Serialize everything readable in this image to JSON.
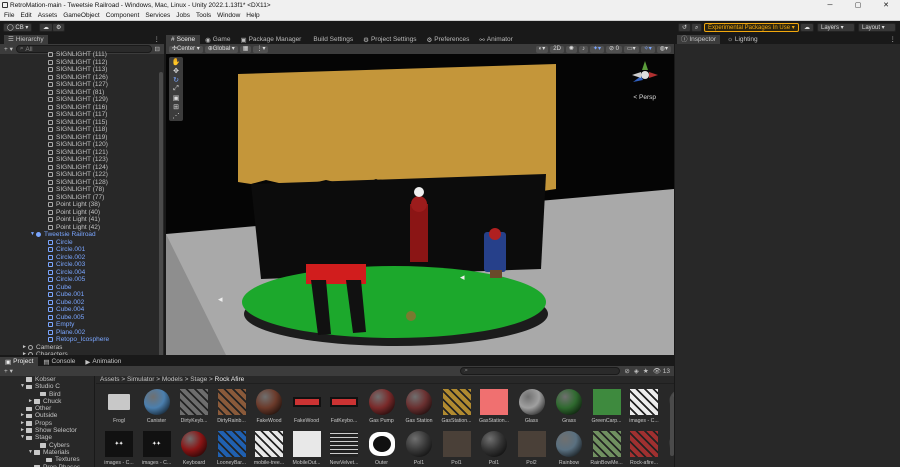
{
  "window": {
    "title": "RetroMation-main - Tweetsie Railroad - Windows, Mac, Linux - Unity 2022.1.13f1* <DX11>",
    "minimize": "─",
    "maximize": "▢",
    "close": "✕"
  },
  "menu": [
    "File",
    "Edit",
    "Assets",
    "GameObject",
    "Component",
    "Services",
    "Jobs",
    "Tools",
    "Window",
    "Help"
  ],
  "toolbar": {
    "account": "CB",
    "experimental": "Experimental Packages In Use",
    "layers": "Layers",
    "layout": "Layout"
  },
  "hierarchy": {
    "tab": "Hierarchy",
    "search_placeholder": "All",
    "rows": [
      {
        "label": "SIGNLIGHT (111)",
        "indent": 48,
        "kind": "obj"
      },
      {
        "label": "SIGNLIGHT (112)",
        "indent": 48,
        "kind": "obj"
      },
      {
        "label": "SIGNLIGHT (113)",
        "indent": 48,
        "kind": "obj"
      },
      {
        "label": "SIGNLIGHT (126)",
        "indent": 48,
        "kind": "obj"
      },
      {
        "label": "SIGNLIGHT (127)",
        "indent": 48,
        "kind": "obj"
      },
      {
        "label": "SIGNLIGHT (81)",
        "indent": 48,
        "kind": "obj"
      },
      {
        "label": "SIGNLIGHT (129)",
        "indent": 48,
        "kind": "obj"
      },
      {
        "label": "SIGNLIGHT (116)",
        "indent": 48,
        "kind": "obj"
      },
      {
        "label": "SIGNLIGHT (117)",
        "indent": 48,
        "kind": "obj"
      },
      {
        "label": "SIGNLIGHT (115)",
        "indent": 48,
        "kind": "obj"
      },
      {
        "label": "SIGNLIGHT (118)",
        "indent": 48,
        "kind": "obj"
      },
      {
        "label": "SIGNLIGHT (119)",
        "indent": 48,
        "kind": "obj"
      },
      {
        "label": "SIGNLIGHT (120)",
        "indent": 48,
        "kind": "obj"
      },
      {
        "label": "SIGNLIGHT (121)",
        "indent": 48,
        "kind": "obj"
      },
      {
        "label": "SIGNLIGHT (123)",
        "indent": 48,
        "kind": "obj"
      },
      {
        "label": "SIGNLIGHT (124)",
        "indent": 48,
        "kind": "obj"
      },
      {
        "label": "SIGNLIGHT (122)",
        "indent": 48,
        "kind": "obj"
      },
      {
        "label": "SIGNLIGHT (128)",
        "indent": 48,
        "kind": "obj"
      },
      {
        "label": "SIGNLIGHT (78)",
        "indent": 48,
        "kind": "obj"
      },
      {
        "label": "SIGNLIGHT (77)",
        "indent": 48,
        "kind": "obj"
      },
      {
        "label": "Point Light (38)",
        "indent": 48,
        "kind": "obj"
      },
      {
        "label": "Point Light (40)",
        "indent": 48,
        "kind": "obj"
      },
      {
        "label": "Point Light (41)",
        "indent": 48,
        "kind": "obj"
      },
      {
        "label": "Point Light (42)",
        "indent": 48,
        "kind": "obj"
      },
      {
        "label": "Tweetsie Railroad",
        "indent": 36,
        "kind": "root",
        "arrow": "▼"
      },
      {
        "label": "Circle",
        "indent": 48,
        "kind": "blue"
      },
      {
        "label": "Circle.001",
        "indent": 48,
        "kind": "blue"
      },
      {
        "label": "Circle.002",
        "indent": 48,
        "kind": "blue"
      },
      {
        "label": "Circle.003",
        "indent": 48,
        "kind": "blue"
      },
      {
        "label": "Circle.004",
        "indent": 48,
        "kind": "blue"
      },
      {
        "label": "Circle.005",
        "indent": 48,
        "kind": "blue"
      },
      {
        "label": "Cube",
        "indent": 48,
        "kind": "blue"
      },
      {
        "label": "Cube.001",
        "indent": 48,
        "kind": "blue"
      },
      {
        "label": "Cube.002",
        "indent": 48,
        "kind": "blue"
      },
      {
        "label": "Cube.004",
        "indent": 48,
        "kind": "blue"
      },
      {
        "label": "Cube.005",
        "indent": 48,
        "kind": "blue"
      },
      {
        "label": "Empty",
        "indent": 48,
        "kind": "blue"
      },
      {
        "label": "Plane.002",
        "indent": 48,
        "kind": "blue"
      },
      {
        "label": "Retopo_Icosphere",
        "indent": 48,
        "kind": "blue"
      },
      {
        "label": "Cameras",
        "indent": 28,
        "kind": "go",
        "arrow": "►"
      },
      {
        "label": "Characters",
        "indent": 28,
        "kind": "go",
        "arrow": "►"
      }
    ]
  },
  "scene_tabs": [
    {
      "label": "Scene",
      "icon": "#",
      "active": true
    },
    {
      "label": "Game",
      "icon": "◉",
      "active": false
    },
    {
      "label": "Package Manager",
      "icon": "▣",
      "active": false
    },
    {
      "label": "Build Settings",
      "icon": "",
      "active": false
    },
    {
      "label": "Project Settings",
      "icon": "⚙",
      "active": false
    },
    {
      "label": "Preferences",
      "icon": "⚙",
      "active": false
    },
    {
      "label": "Animator",
      "icon": "⚯",
      "active": false
    }
  ],
  "scene_tools": {
    "pivot": "Center",
    "space": "Global",
    "mode_2d": "2D",
    "persp": "< Persp"
  },
  "inspector": {
    "tab1": "Inspector",
    "tab2": "Lighting"
  },
  "bottom_tabs": [
    {
      "label": "Project",
      "active": true
    },
    {
      "label": "Console",
      "active": false
    },
    {
      "label": "Animation",
      "active": false
    }
  ],
  "project": {
    "count": "13",
    "folders": [
      {
        "label": "Kobser",
        "indent": 28
      },
      {
        "label": "Studio C",
        "indent": 28,
        "arrow": "▼"
      },
      {
        "label": "Bird",
        "indent": 42
      },
      {
        "label": "Chuck",
        "indent": 36,
        "arrow": "►"
      },
      {
        "label": "Other",
        "indent": 28
      },
      {
        "label": "Outside",
        "indent": 28,
        "arrow": "►"
      },
      {
        "label": "Props",
        "indent": 28,
        "arrow": "►"
      },
      {
        "label": "Show Selector",
        "indent": 28,
        "arrow": "►"
      },
      {
        "label": "Stage",
        "indent": 28,
        "arrow": "▼"
      },
      {
        "label": "Cybers",
        "indent": 42
      },
      {
        "label": "Materials",
        "indent": 36,
        "arrow": "▼"
      },
      {
        "label": "Textures",
        "indent": 48
      },
      {
        "label": "Prop Phases",
        "indent": 36
      }
    ],
    "breadcrumb": [
      "Assets",
      "Simulator",
      "Models",
      "Stage",
      "Rock Afire"
    ],
    "assets_row1": [
      {
        "label": "Frogl",
        "kind": "folder"
      },
      {
        "label": "Canister",
        "kind": "sphere",
        "color": "#4b7fae"
      },
      {
        "label": "DirtyKeyb...",
        "kind": "pattern",
        "color": "#6d6d6d"
      },
      {
        "label": "DirtyRainb...",
        "kind": "pattern",
        "color": "#8a5a3a"
      },
      {
        "label": "FakeWood",
        "kind": "sphere",
        "color": "#6b3a2a"
      },
      {
        "label": "FakeWood",
        "kind": "redbar",
        "color": "#c33"
      },
      {
        "label": "FatKeybo...",
        "kind": "redbar",
        "color": "#c33"
      },
      {
        "label": "Gas Pump",
        "kind": "sphere",
        "color": "#7a2a2a"
      },
      {
        "label": "Gas Station",
        "kind": "sphere",
        "color": "#6a3030"
      },
      {
        "label": "GasStation...",
        "kind": "pattern",
        "color": "#b08a30"
      },
      {
        "label": "GasStation...",
        "kind": "square",
        "color": "#f07070"
      },
      {
        "label": "Glass",
        "kind": "sphere",
        "color": "#a0a0a0"
      },
      {
        "label": "Grass",
        "kind": "sphere",
        "color": "#2f6a2f"
      },
      {
        "label": "GreenCarp...",
        "kind": "square",
        "color": "#3e8a3e"
      },
      {
        "label": "images - C...",
        "kind": "pattern",
        "color": "#ececec"
      },
      {
        "label": "",
        "kind": "sphere",
        "color": "#2a2a2a"
      }
    ],
    "assets_row2": [
      {
        "label": "images - C...",
        "kind": "text",
        "color": "#111"
      },
      {
        "label": "images - C...",
        "kind": "text",
        "color": "#111"
      },
      {
        "label": "Keyboard",
        "kind": "sphere",
        "color": "#8a1515"
      },
      {
        "label": "LooneyBar...",
        "kind": "pattern",
        "color": "#2060b0"
      },
      {
        "label": "mobile-tree...",
        "kind": "pattern",
        "color": "#e8e8e8"
      },
      {
        "label": "MobileOut...",
        "kind": "square",
        "color": "#e8e8e8"
      },
      {
        "label": "NewVelvet...",
        "kind": "lines",
        "color": "#222"
      },
      {
        "label": "Outer",
        "kind": "splat",
        "color": "#111"
      },
      {
        "label": "Pol1",
        "kind": "sphere",
        "color": "#3a3a3a"
      },
      {
        "label": "Pol1",
        "kind": "square",
        "color": "#4a4038"
      },
      {
        "label": "Pol1",
        "kind": "sphere",
        "color": "#353535"
      },
      {
        "label": "Pol2",
        "kind": "square",
        "color": "#4a4038"
      },
      {
        "label": "Rainbow",
        "kind": "sphere",
        "color": "#5a7080"
      },
      {
        "label": "RainBowMe...",
        "kind": "pattern",
        "color": "#709060"
      },
      {
        "label": "Rock-afire...",
        "kind": "pattern",
        "color": "#a03030"
      },
      {
        "label": "",
        "kind": "sphere",
        "color": "#303030"
      }
    ]
  },
  "colors": {
    "accent": "#f2a70d",
    "selection": "#7aa6ff",
    "bg": "#282828"
  }
}
